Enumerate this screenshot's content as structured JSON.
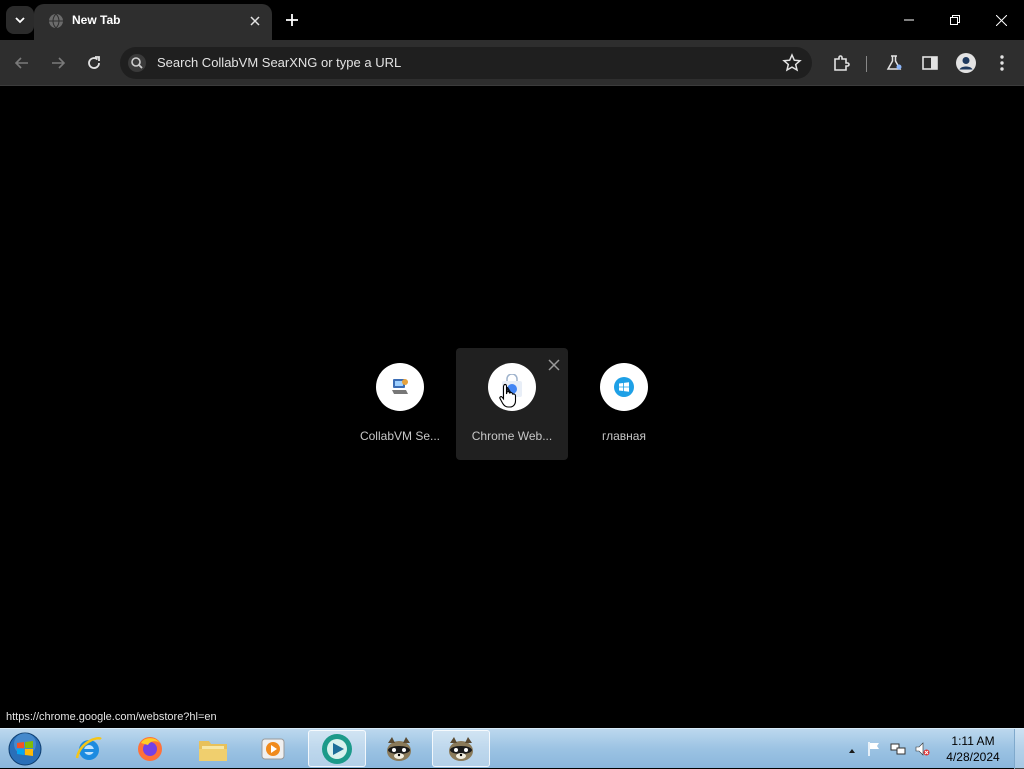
{
  "browser": {
    "tab": {
      "title": "New Tab"
    },
    "omnibox": {
      "placeholder": "Search CollabVM SearXNG or type a URL"
    }
  },
  "new_tab_page": {
    "shortcuts": [
      {
        "label": "CollabVM Se..."
      },
      {
        "label": "Chrome Web..."
      },
      {
        "label": "главная"
      }
    ],
    "status_url": "https://chrome.google.com/webstore?hl=en"
  },
  "taskbar": {
    "clock": {
      "time": "1:11 AM",
      "date": "4/28/2024"
    }
  },
  "colors": {
    "tab_bg": "#2e2e2e",
    "content_bg": "#000000",
    "taskbar_top": "#bcd8ee",
    "windows_logo_blue": "#1ea0e6"
  },
  "icons": {
    "tab_search": "chevron-down-icon",
    "favicon": "globe-icon",
    "back": "arrow-left-icon",
    "forward": "arrow-right-icon",
    "reload": "reload-icon",
    "bookmark": "star-icon",
    "extensions": "puzzle-icon",
    "labs": "flask-icon",
    "side_panel": "side-panel-icon",
    "profile": "person-icon",
    "menu": "kebab-menu-icon"
  }
}
